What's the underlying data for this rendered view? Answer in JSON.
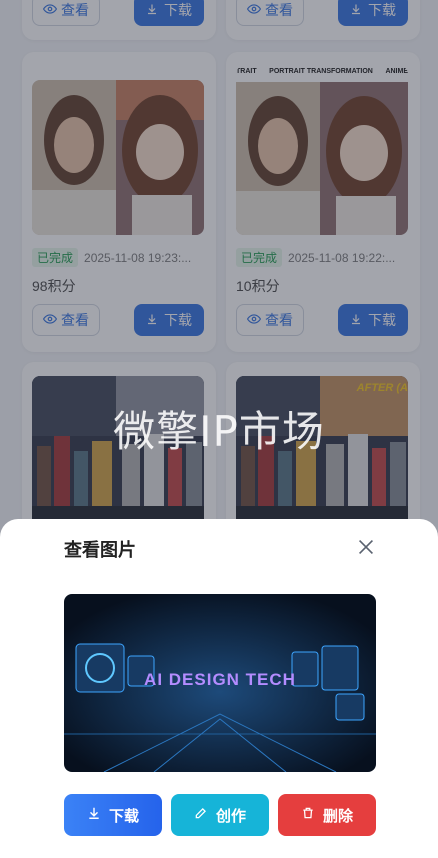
{
  "gallery": {
    "cards": [
      {
        "status": "",
        "date": "",
        "points": "",
        "view_label": "查看",
        "download_label": "下载"
      },
      {
        "status": "",
        "date": "",
        "points": "",
        "view_label": "查看",
        "download_label": "下载"
      },
      {
        "status": "已完成",
        "date": "2025-11-08 19:23:...",
        "points": "98积分",
        "view_label": "查看",
        "download_label": "下载"
      },
      {
        "status": "已完成",
        "date": "2025-11-08 19:22:...",
        "points": "10积分",
        "view_label": "查看",
        "download_label": "下载",
        "thumb_caption_left": "TRAIT",
        "thumb_caption_mid": "PORTRAIT TRANSFORMATION",
        "thumb_caption_right": "ANIME"
      },
      {
        "status": "",
        "date": "",
        "points": ""
      },
      {
        "status": "",
        "date": "",
        "points": "",
        "thumb_caption_right": "AFTER (A"
      }
    ]
  },
  "watermark": "微擎IP市场",
  "modal": {
    "title": "查看图片",
    "preview_text": "AI DESIGN TECH",
    "buttons": {
      "download": "下载",
      "create": "创作",
      "delete": "删除"
    }
  },
  "colors": {
    "primary": "#2f6fe0",
    "download_gradient": "#3b82f6",
    "create": "#16b4d8",
    "delete": "#e53e3e",
    "success": "#1b9a4b"
  }
}
